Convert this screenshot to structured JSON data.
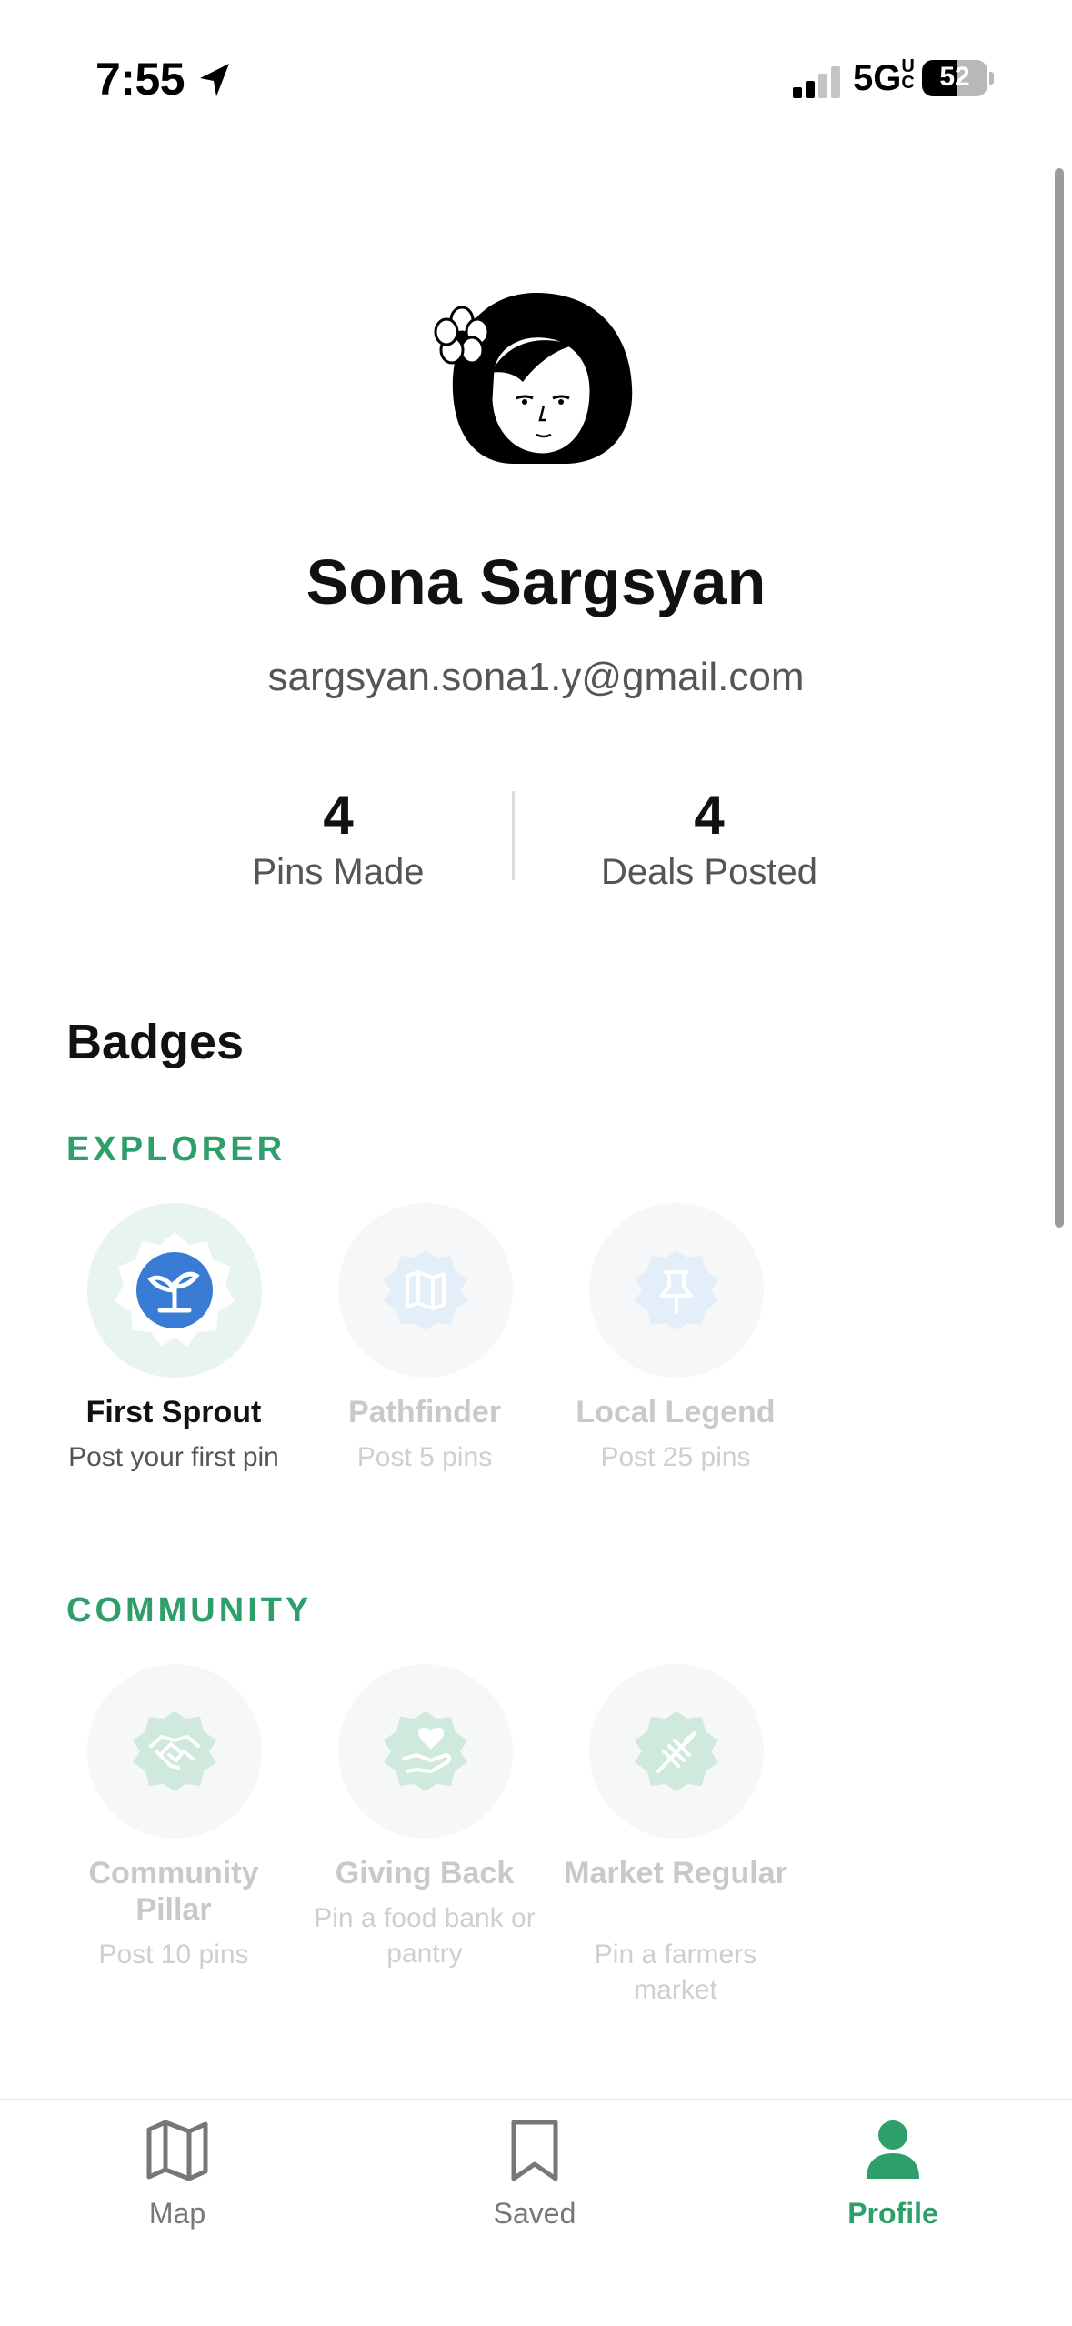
{
  "status_bar": {
    "time": "7:55",
    "network": "5G",
    "network_suffix": "UC",
    "battery": "52"
  },
  "profile": {
    "name": "Sona Sargsyan",
    "email": "sargsyan.sona1.y@gmail.com",
    "stats": [
      {
        "value": "4",
        "label": "Pins Made"
      },
      {
        "value": "4",
        "label": "Deals Posted"
      }
    ]
  },
  "badges": {
    "title": "Badges",
    "groups": [
      {
        "title": "EXPLORER",
        "items": [
          {
            "name": "First Sprout",
            "desc": "Post your first pin",
            "earned": true,
            "icon": "sprout-icon"
          },
          {
            "name": "Pathfinder",
            "desc": "Post 5 pins",
            "earned": false,
            "icon": "map-icon"
          },
          {
            "name": "Local Legend",
            "desc": "Post 25 pins",
            "earned": false,
            "icon": "pushpin-icon"
          }
        ]
      },
      {
        "title": "COMMUNITY",
        "items": [
          {
            "name": "Community Pillar",
            "desc": "Post 10 pins",
            "earned": false,
            "icon": "handshake-icon"
          },
          {
            "name": "Giving Back",
            "desc": "Pin a food bank or pantry",
            "earned": false,
            "icon": "heart-hand-icon"
          },
          {
            "name": "Market Regular",
            "desc": "Pin a farmers market",
            "earned": false,
            "icon": "wheat-icon"
          }
        ]
      }
    ]
  },
  "tabs": [
    {
      "label": "Map",
      "icon": "map-icon",
      "active": false
    },
    {
      "label": "Saved",
      "icon": "bookmark-icon",
      "active": false
    },
    {
      "label": "Profile",
      "icon": "person-icon",
      "active": true
    }
  ],
  "colors": {
    "accent": "#2e9e6a",
    "earned_badge": "#3a7bd5",
    "locked_badge": "#e3eef8",
    "locked_green": "#cfe9dc"
  }
}
